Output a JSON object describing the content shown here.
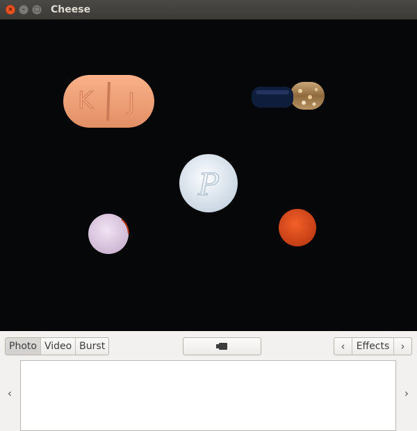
{
  "window": {
    "title": "Cheese"
  },
  "titlebar": {
    "close_glyph": "×",
    "minimize_glyph": "–",
    "maximize_glyph": "□"
  },
  "pill": {
    "left_letter": "K",
    "right_letter": "J"
  },
  "round_pill": {
    "imprint": "P"
  },
  "mode_tabs": [
    {
      "label": "Photo",
      "active": true
    },
    {
      "label": "Video",
      "active": false
    },
    {
      "label": "Burst",
      "active": false
    }
  ],
  "capture": {
    "icon": "camera-icon"
  },
  "effects": {
    "label": "Effects",
    "prev_glyph": "‹",
    "next_glyph": "›"
  },
  "thumbnails": {
    "prev_glyph": "‹",
    "next_glyph": "›",
    "items": []
  }
}
